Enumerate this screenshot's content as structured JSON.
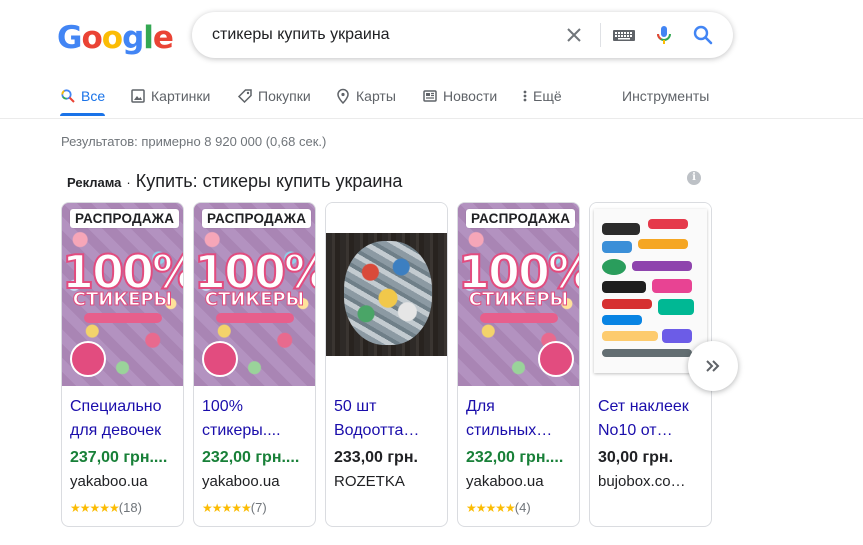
{
  "search": {
    "query": "стикеры купить украина"
  },
  "tabs": [
    {
      "label": "Все",
      "icon": "search-icon",
      "active": true
    },
    {
      "label": "Картинки",
      "icon": "image-icon"
    },
    {
      "label": "Покупки",
      "icon": "tag-icon"
    },
    {
      "label": "Карты",
      "icon": "map-pin-icon"
    },
    {
      "label": "Новости",
      "icon": "news-icon"
    },
    {
      "label": "Ещё",
      "icon": "more-vert-icon"
    }
  ],
  "tools_label": "Инструменты",
  "stats": "Результатов: примерно 8 920 000 (0,68 сек.)",
  "ads": {
    "label": "Реклама",
    "dot": "·",
    "title": "Купить: стикеры купить украина",
    "cards": [
      {
        "badge": "РАСПРОДАЖА",
        "title_line1": "Специально",
        "title_line2": "для девочек",
        "price": "237,00 грн....",
        "price_color": "#188038",
        "store": "yakaboo.ua",
        "stars": "★★★★★",
        "rating_count": "(18)"
      },
      {
        "badge": "РАСПРОДАЖА",
        "title_line1": "100%",
        "title_line2": "стикеры....",
        "price": "232,00 грн....",
        "price_color": "#188038",
        "store": "yakaboo.ua",
        "stars": "★★★★★",
        "rating_count": "(7)"
      },
      {
        "badge": "",
        "title_line1": "50 шт",
        "title_line2": "Водоотта…",
        "price": "233,00 грн.",
        "price_color": "#202124",
        "store": "ROZETKA",
        "stars": "",
        "rating_count": ""
      },
      {
        "badge": "РАСПРОДАЖА",
        "title_line1": "Для",
        "title_line2": "стильных…",
        "price": "232,00 грн....",
        "price_color": "#188038",
        "store": "yakaboo.ua",
        "stars": "★★★★★",
        "rating_count": "(4)"
      },
      {
        "badge": "",
        "title_line1": "Сет наклеек",
        "title_line2": "No10 от…",
        "price": "30,00 грн.",
        "price_color": "#202124",
        "store": "bujobox.co…",
        "stars": "",
        "rating_count": ""
      }
    ]
  },
  "book_cover": {
    "big": "100%",
    "word": "СТИКЕРЫ"
  },
  "next_icon": "chevron-double-right-icon",
  "colors": {
    "accent": "#1a73e8",
    "link": "#1a0dab",
    "price_green": "#188038",
    "star": "#fbbc04"
  }
}
